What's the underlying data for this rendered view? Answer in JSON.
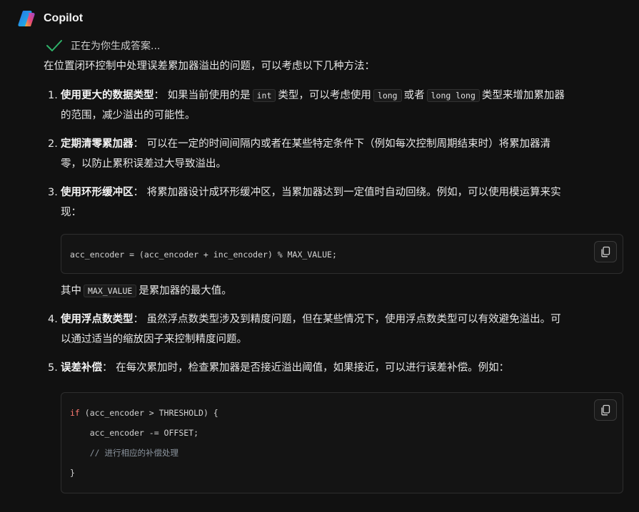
{
  "header": {
    "brand": "Copilot"
  },
  "status": {
    "text": "正在为你生成答案..."
  },
  "intro": "在位置闭环控制中处理误差累加器溢出的问题，可以考虑以下几种方法：",
  "steps": [
    {
      "num": "1.",
      "title": "使用更大的数据类型",
      "sep": "：",
      "p1": "如果当前使用的是",
      "code1": "int",
      "p2": "类型，可以考虑使用",
      "code2": "long",
      "p3": "或者",
      "code3": "long long",
      "p4": "类型来增加累加器",
      "line2": "的范围，减少溢出的可能性。"
    },
    {
      "num": "2.",
      "title": "定期清零累加器",
      "sep": "：",
      "line1": "可以在一定的时间间隔内或者在某些特定条件下（例如每次控制周期结束时）将累加器清",
      "line2": "零，以防止累积误差过大导致溢出。"
    },
    {
      "num": "3.",
      "title": "使用环形缓冲区",
      "sep": "：",
      "line1": "将累加器设计成环形缓冲区，当累加器达到一定值时自动回绕。例如，可以使用模运算来实",
      "line2": "现：",
      "code_line": "acc_encoder = (acc_encoder + inc_encoder) % MAX_VALUE;",
      "after_p1": "其中",
      "after_code": "MAX_VALUE",
      "after_p2": "是累加器的最大值。"
    },
    {
      "num": "4.",
      "title": "使用浮点数类型",
      "sep": "：",
      "line1": "虽然浮点数类型涉及到精度问题，但在某些情况下，使用浮点数类型可以有效避免溢出。可",
      "line2": "以通过适当的缩放因子来控制精度问题。"
    },
    {
      "num": "5.",
      "title": "误差补偿",
      "sep": "：",
      "line1": "在每次累加时，检查累加器是否接近溢出阈值，如果接近，可以进行误差补偿。例如：",
      "code": {
        "kw_if": "if",
        "l1_rest": " (acc_encoder > THRESHOLD) {",
        "l2": "    acc_encoder -= OFFSET;",
        "l3": "    // 进行相应的补偿处理",
        "l4": "}"
      }
    }
  ],
  "icons": {
    "logo": "copilot-logo",
    "check": "check-icon",
    "copy": "copy-icon"
  },
  "colors": {
    "background": "#111111",
    "check": "#2fb36a",
    "keyword": "#ff7b72",
    "comment": "#8b949e"
  }
}
